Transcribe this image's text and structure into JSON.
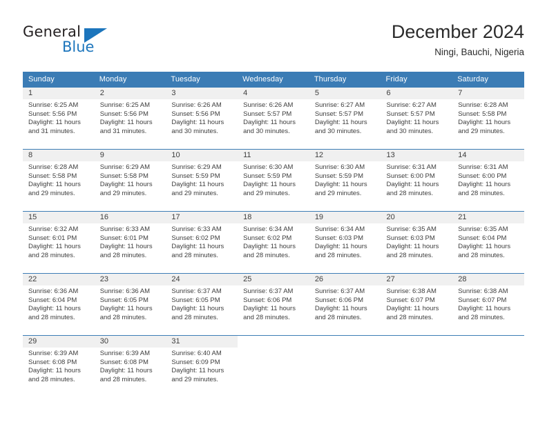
{
  "brand": {
    "name_top": "General",
    "name_bottom": "Blue",
    "accent_color": "#1c75bc",
    "triangle_icon": "triangle-icon"
  },
  "header": {
    "title": "December 2024",
    "subtitle": "Ningi, Bauchi, Nigeria"
  },
  "calendar": {
    "header_bg": "#3b7cb5",
    "daynum_band_bg": "#f0f0f0",
    "weekday_headers": [
      "Sunday",
      "Monday",
      "Tuesday",
      "Wednesday",
      "Thursday",
      "Friday",
      "Saturday"
    ],
    "labels": {
      "sunrise": "Sunrise:",
      "sunset": "Sunset:",
      "daylight": "Daylight:"
    },
    "weeks": [
      [
        {
          "day": "1",
          "sunrise": "Sunrise: 6:25 AM",
          "sunset": "Sunset: 5:56 PM",
          "daylight_line1": "Daylight: 11 hours",
          "daylight_line2": "and 31 minutes."
        },
        {
          "day": "2",
          "sunrise": "Sunrise: 6:25 AM",
          "sunset": "Sunset: 5:56 PM",
          "daylight_line1": "Daylight: 11 hours",
          "daylight_line2": "and 31 minutes."
        },
        {
          "day": "3",
          "sunrise": "Sunrise: 6:26 AM",
          "sunset": "Sunset: 5:56 PM",
          "daylight_line1": "Daylight: 11 hours",
          "daylight_line2": "and 30 minutes."
        },
        {
          "day": "4",
          "sunrise": "Sunrise: 6:26 AM",
          "sunset": "Sunset: 5:57 PM",
          "daylight_line1": "Daylight: 11 hours",
          "daylight_line2": "and 30 minutes."
        },
        {
          "day": "5",
          "sunrise": "Sunrise: 6:27 AM",
          "sunset": "Sunset: 5:57 PM",
          "daylight_line1": "Daylight: 11 hours",
          "daylight_line2": "and 30 minutes."
        },
        {
          "day": "6",
          "sunrise": "Sunrise: 6:27 AM",
          "sunset": "Sunset: 5:57 PM",
          "daylight_line1": "Daylight: 11 hours",
          "daylight_line2": "and 30 minutes."
        },
        {
          "day": "7",
          "sunrise": "Sunrise: 6:28 AM",
          "sunset": "Sunset: 5:58 PM",
          "daylight_line1": "Daylight: 11 hours",
          "daylight_line2": "and 29 minutes."
        }
      ],
      [
        {
          "day": "8",
          "sunrise": "Sunrise: 6:28 AM",
          "sunset": "Sunset: 5:58 PM",
          "daylight_line1": "Daylight: 11 hours",
          "daylight_line2": "and 29 minutes."
        },
        {
          "day": "9",
          "sunrise": "Sunrise: 6:29 AM",
          "sunset": "Sunset: 5:58 PM",
          "daylight_line1": "Daylight: 11 hours",
          "daylight_line2": "and 29 minutes."
        },
        {
          "day": "10",
          "sunrise": "Sunrise: 6:29 AM",
          "sunset": "Sunset: 5:59 PM",
          "daylight_line1": "Daylight: 11 hours",
          "daylight_line2": "and 29 minutes."
        },
        {
          "day": "11",
          "sunrise": "Sunrise: 6:30 AM",
          "sunset": "Sunset: 5:59 PM",
          "daylight_line1": "Daylight: 11 hours",
          "daylight_line2": "and 29 minutes."
        },
        {
          "day": "12",
          "sunrise": "Sunrise: 6:30 AM",
          "sunset": "Sunset: 5:59 PM",
          "daylight_line1": "Daylight: 11 hours",
          "daylight_line2": "and 29 minutes."
        },
        {
          "day": "13",
          "sunrise": "Sunrise: 6:31 AM",
          "sunset": "Sunset: 6:00 PM",
          "daylight_line1": "Daylight: 11 hours",
          "daylight_line2": "and 28 minutes."
        },
        {
          "day": "14",
          "sunrise": "Sunrise: 6:31 AM",
          "sunset": "Sunset: 6:00 PM",
          "daylight_line1": "Daylight: 11 hours",
          "daylight_line2": "and 28 minutes."
        }
      ],
      [
        {
          "day": "15",
          "sunrise": "Sunrise: 6:32 AM",
          "sunset": "Sunset: 6:01 PM",
          "daylight_line1": "Daylight: 11 hours",
          "daylight_line2": "and 28 minutes."
        },
        {
          "day": "16",
          "sunrise": "Sunrise: 6:33 AM",
          "sunset": "Sunset: 6:01 PM",
          "daylight_line1": "Daylight: 11 hours",
          "daylight_line2": "and 28 minutes."
        },
        {
          "day": "17",
          "sunrise": "Sunrise: 6:33 AM",
          "sunset": "Sunset: 6:02 PM",
          "daylight_line1": "Daylight: 11 hours",
          "daylight_line2": "and 28 minutes."
        },
        {
          "day": "18",
          "sunrise": "Sunrise: 6:34 AM",
          "sunset": "Sunset: 6:02 PM",
          "daylight_line1": "Daylight: 11 hours",
          "daylight_line2": "and 28 minutes."
        },
        {
          "day": "19",
          "sunrise": "Sunrise: 6:34 AM",
          "sunset": "Sunset: 6:03 PM",
          "daylight_line1": "Daylight: 11 hours",
          "daylight_line2": "and 28 minutes."
        },
        {
          "day": "20",
          "sunrise": "Sunrise: 6:35 AM",
          "sunset": "Sunset: 6:03 PM",
          "daylight_line1": "Daylight: 11 hours",
          "daylight_line2": "and 28 minutes."
        },
        {
          "day": "21",
          "sunrise": "Sunrise: 6:35 AM",
          "sunset": "Sunset: 6:04 PM",
          "daylight_line1": "Daylight: 11 hours",
          "daylight_line2": "and 28 minutes."
        }
      ],
      [
        {
          "day": "22",
          "sunrise": "Sunrise: 6:36 AM",
          "sunset": "Sunset: 6:04 PM",
          "daylight_line1": "Daylight: 11 hours",
          "daylight_line2": "and 28 minutes."
        },
        {
          "day": "23",
          "sunrise": "Sunrise: 6:36 AM",
          "sunset": "Sunset: 6:05 PM",
          "daylight_line1": "Daylight: 11 hours",
          "daylight_line2": "and 28 minutes."
        },
        {
          "day": "24",
          "sunrise": "Sunrise: 6:37 AM",
          "sunset": "Sunset: 6:05 PM",
          "daylight_line1": "Daylight: 11 hours",
          "daylight_line2": "and 28 minutes."
        },
        {
          "day": "25",
          "sunrise": "Sunrise: 6:37 AM",
          "sunset": "Sunset: 6:06 PM",
          "daylight_line1": "Daylight: 11 hours",
          "daylight_line2": "and 28 minutes."
        },
        {
          "day": "26",
          "sunrise": "Sunrise: 6:37 AM",
          "sunset": "Sunset: 6:06 PM",
          "daylight_line1": "Daylight: 11 hours",
          "daylight_line2": "and 28 minutes."
        },
        {
          "day": "27",
          "sunrise": "Sunrise: 6:38 AM",
          "sunset": "Sunset: 6:07 PM",
          "daylight_line1": "Daylight: 11 hours",
          "daylight_line2": "and 28 minutes."
        },
        {
          "day": "28",
          "sunrise": "Sunrise: 6:38 AM",
          "sunset": "Sunset: 6:07 PM",
          "daylight_line1": "Daylight: 11 hours",
          "daylight_line2": "and 28 minutes."
        }
      ],
      [
        {
          "day": "29",
          "sunrise": "Sunrise: 6:39 AM",
          "sunset": "Sunset: 6:08 PM",
          "daylight_line1": "Daylight: 11 hours",
          "daylight_line2": "and 28 minutes."
        },
        {
          "day": "30",
          "sunrise": "Sunrise: 6:39 AM",
          "sunset": "Sunset: 6:08 PM",
          "daylight_line1": "Daylight: 11 hours",
          "daylight_line2": "and 28 minutes."
        },
        {
          "day": "31",
          "sunrise": "Sunrise: 6:40 AM",
          "sunset": "Sunset: 6:09 PM",
          "daylight_line1": "Daylight: 11 hours",
          "daylight_line2": "and 29 minutes."
        },
        {
          "day": "",
          "sunrise": "",
          "sunset": "",
          "daylight_line1": "",
          "daylight_line2": ""
        },
        {
          "day": "",
          "sunrise": "",
          "sunset": "",
          "daylight_line1": "",
          "daylight_line2": ""
        },
        {
          "day": "",
          "sunrise": "",
          "sunset": "",
          "daylight_line1": "",
          "daylight_line2": ""
        },
        {
          "day": "",
          "sunrise": "",
          "sunset": "",
          "daylight_line1": "",
          "daylight_line2": ""
        }
      ]
    ]
  }
}
